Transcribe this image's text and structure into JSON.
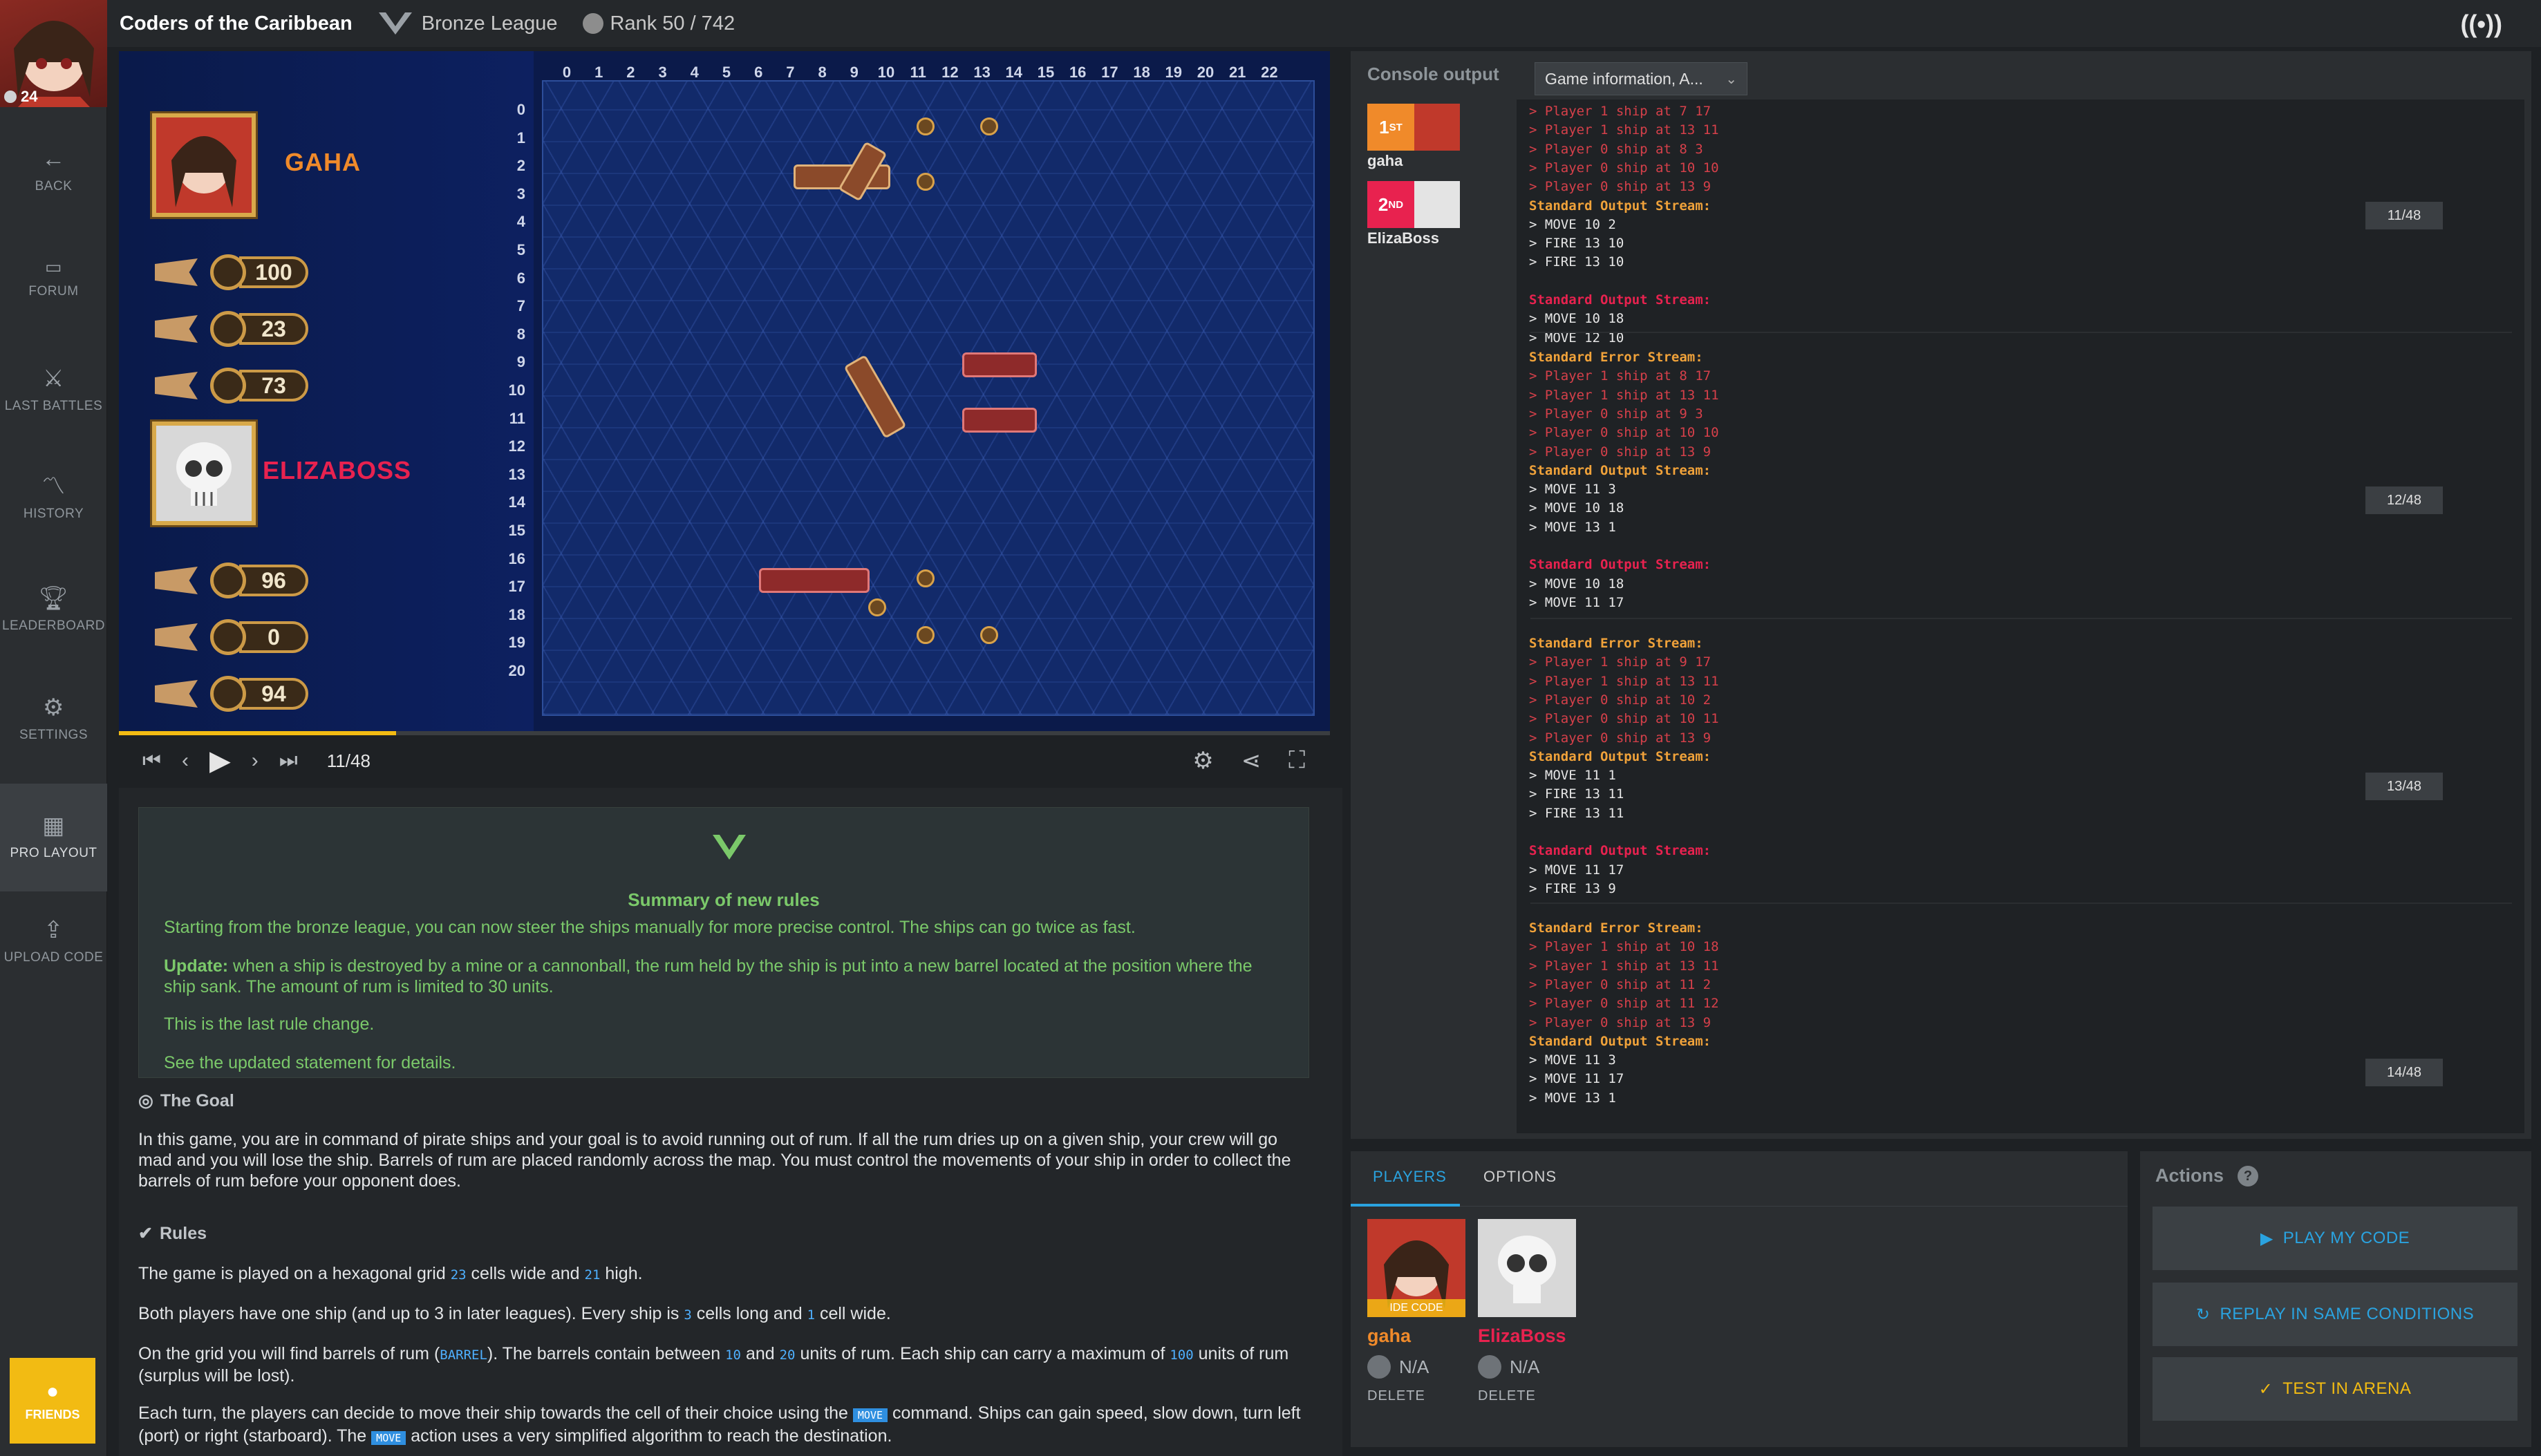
{
  "sidebar": {
    "level": "24",
    "items": [
      {
        "label": "BACK",
        "icon": "arrow-left-icon"
      },
      {
        "label": "FORUM",
        "icon": "chat-icon"
      },
      {
        "label": "LAST BATTLES",
        "icon": "battle-icon"
      },
      {
        "label": "HISTORY",
        "icon": "chart-line-icon"
      },
      {
        "label": "LEADERBOARD",
        "icon": "trophy-icon"
      },
      {
        "label": "SETTINGS",
        "icon": "gear-icon"
      },
      {
        "label": "PRO LAYOUT",
        "icon": "grid-icon"
      },
      {
        "label": "UPLOAD CODE",
        "icon": "upload-icon"
      }
    ],
    "friends": "FRIENDS"
  },
  "topbar": {
    "title": "Coders of the Caribbean",
    "league": "Bronze League",
    "rank": "Rank 50 / 742"
  },
  "game": {
    "players": [
      {
        "name": "GAHA",
        "color": "#f08a2a",
        "ships": [
          "100",
          "23",
          "73"
        ]
      },
      {
        "name": "ELIZABOSS",
        "color": "#e8224f",
        "ships": [
          "96",
          "0",
          "94"
        ]
      }
    ],
    "x_labels": [
      "0",
      "1",
      "2",
      "3",
      "4",
      "5",
      "6",
      "7",
      "8",
      "9",
      "10",
      "11",
      "12",
      "13",
      "14",
      "15",
      "16",
      "17",
      "18",
      "19",
      "20",
      "21",
      "22"
    ],
    "y_labels": [
      "0",
      "1",
      "2",
      "3",
      "4",
      "5",
      "6",
      "7",
      "8",
      "9",
      "10",
      "11",
      "12",
      "13",
      "14",
      "15",
      "16",
      "17",
      "18",
      "19",
      "20"
    ],
    "progress": 0.229,
    "frame": "11/48"
  },
  "statement": {
    "summary_title": "Summary of new rules",
    "summary_p1": "Starting from the bronze league, you can now steer the ships manually for more precise control. The ships can go twice as fast.",
    "update_label": "Update:",
    "summary_p2": " when a ship is destroyed by a mine or a cannonball, the rum held by the ship is put into a new barrel located at the position where the ship sank. The amount of rum is limited to 30 units.",
    "summary_p3": "This is the last rule change.",
    "summary_p4": "See the updated statement for details.",
    "goal_title": "The Goal",
    "goal_text": "In this game, you are in command of pirate ships and your goal is to avoid running out of rum. If all the rum dries up on a given ship, your crew will go mad and you will lose the ship. Barrels of rum are placed randomly across the map. You must control the movements of your ship in order to collect the barrels of rum before your opponent does.",
    "rules_title": "Rules",
    "r1a": "The game is played on a hexagonal grid ",
    "r1k1": "23",
    "r1b": " cells wide and ",
    "r1k2": "21",
    "r1c": " high.",
    "r2a": "Both players have one ship (and up to 3 in later leagues). Every ship is ",
    "r2k1": "3",
    "r2b": " cells long and ",
    "r2k2": "1",
    "r2c": " cell wide.",
    "r3a": "On the grid you will find barrels of rum (",
    "r3k1": "BARREL",
    "r3b": "). The barrels contain between ",
    "r3k2": "10",
    "r3c": " and ",
    "r3k3": "20",
    "r3d": " units of rum. Each ship can carry a maximum of ",
    "r3k4": "100",
    "r3e": " units of rum (surplus will be lost).",
    "r4a": "Each turn, the players can decide to move their ship towards the cell of their choice using the ",
    "r4k1": "MOVE",
    "r4b": " command. Ships can gain speed, slow down, turn left (port) or right (starboard). The ",
    "r4k2": "MOVE",
    "r4c": " action uses a very simplified algorithm to reach the destination."
  },
  "console": {
    "title": "Console output",
    "dropdown": "Game information, A...",
    "ranks": [
      {
        "pos": "1",
        "sup": "ST",
        "name": "gaha",
        "color": "#f08a2a"
      },
      {
        "pos": "2",
        "sup": "ND",
        "name": "ElizaBoss",
        "color": "#e8224f"
      }
    ],
    "blocks": [
      {
        "turn": "11/48",
        "lines": [
          {
            "t": "> Player 1 ship at 7 17",
            "c": "err"
          },
          {
            "t": "> Player 1 ship at 13 11",
            "c": "err"
          },
          {
            "t": "> Player 0 ship at 8 3",
            "c": "err"
          },
          {
            "t": "> Player 0 ship at 10 10",
            "c": "err"
          },
          {
            "t": "> Player 0 ship at 13 9",
            "c": "err"
          },
          {
            "t": "Standard Output Stream:",
            "c": "hdr1"
          },
          {
            "t": "> MOVE 10 2",
            "c": "out"
          },
          {
            "t": "> FIRE 13 10",
            "c": "out"
          },
          {
            "t": "> FIRE 13 10",
            "c": "out"
          },
          {
            "t": "",
            "c": "out"
          },
          {
            "t": "Standard Output Stream:",
            "c": "hdr2"
          },
          {
            "t": "> MOVE 10 18",
            "c": "out"
          },
          {
            "t": "> MOVE 12 10",
            "c": "out"
          }
        ]
      },
      {
        "turn": "12/48",
        "lines": [
          {
            "t": "Standard Error Stream:",
            "c": "hdr1"
          },
          {
            "t": "> Player 1 ship at 8 17",
            "c": "err"
          },
          {
            "t": "> Player 1 ship at 13 11",
            "c": "err"
          },
          {
            "t": "> Player 0 ship at 9 3",
            "c": "err"
          },
          {
            "t": "> Player 0 ship at 10 10",
            "c": "err"
          },
          {
            "t": "> Player 0 ship at 13 9",
            "c": "err"
          },
          {
            "t": "Standard Output Stream:",
            "c": "hdr1"
          },
          {
            "t": "> MOVE 11 3",
            "c": "out"
          },
          {
            "t": "> MOVE 10 18",
            "c": "out"
          },
          {
            "t": "> MOVE 13 1",
            "c": "out"
          },
          {
            "t": "",
            "c": "out"
          },
          {
            "t": "Standard Output Stream:",
            "c": "hdr2"
          },
          {
            "t": "> MOVE 10 18",
            "c": "out"
          },
          {
            "t": "> MOVE 11 17",
            "c": "out"
          }
        ]
      },
      {
        "turn": "13/48",
        "lines": [
          {
            "t": "Standard Error Stream:",
            "c": "hdr1"
          },
          {
            "t": "> Player 1 ship at 9 17",
            "c": "err"
          },
          {
            "t": "> Player 1 ship at 13 11",
            "c": "err"
          },
          {
            "t": "> Player 0 ship at 10 2",
            "c": "err"
          },
          {
            "t": "> Player 0 ship at 10 11",
            "c": "err"
          },
          {
            "t": "> Player 0 ship at 13 9",
            "c": "err"
          },
          {
            "t": "Standard Output Stream:",
            "c": "hdr1"
          },
          {
            "t": "> MOVE 11 1",
            "c": "out"
          },
          {
            "t": "> FIRE 13 11",
            "c": "out"
          },
          {
            "t": "> FIRE 13 11",
            "c": "out"
          },
          {
            "t": "",
            "c": "out"
          },
          {
            "t": "Standard Output Stream:",
            "c": "hdr2"
          },
          {
            "t": "> MOVE 11 17",
            "c": "out"
          },
          {
            "t": "> FIRE 13 9",
            "c": "out"
          }
        ]
      },
      {
        "turn": "14/48",
        "lines": [
          {
            "t": "Standard Error Stream:",
            "c": "hdr1"
          },
          {
            "t": "> Player 1 ship at 10 18",
            "c": "err"
          },
          {
            "t": "> Player 1 ship at 13 11",
            "c": "err"
          },
          {
            "t": "> Player 0 ship at 11 2",
            "c": "err"
          },
          {
            "t": "> Player 0 ship at 11 12",
            "c": "err"
          },
          {
            "t": "> Player 0 ship at 13 9",
            "c": "err"
          },
          {
            "t": "Standard Output Stream:",
            "c": "hdr1"
          },
          {
            "t": "> MOVE 11 3",
            "c": "out"
          },
          {
            "t": "> MOVE 11 17",
            "c": "out"
          },
          {
            "t": "> MOVE 13 1",
            "c": "out"
          }
        ]
      }
    ]
  },
  "players_panel": {
    "tab_players": "PLAYERS",
    "tab_options": "OPTIONS",
    "cards": [
      {
        "name": "gaha",
        "rank": "N/A",
        "delete": "DELETE",
        "badge": "IDE CODE",
        "color": "#f08a2a"
      },
      {
        "name": "ElizaBoss",
        "rank": "N/A",
        "delete": "DELETE",
        "badge": "",
        "color": "#e8224f"
      }
    ]
  },
  "actions": {
    "title": "Actions",
    "help": "?",
    "play": "PLAY MY CODE",
    "replay": "REPLAY IN SAME CONDITIONS",
    "arena": "TEST IN ARENA"
  },
  "colors": {
    "accent": "#f2bb13",
    "error_text": "#d6404a",
    "header1": "#f0a23a",
    "header2": "#e8224f",
    "summary_green": "#7bc96a",
    "link_blue": "#2aa3e0"
  }
}
